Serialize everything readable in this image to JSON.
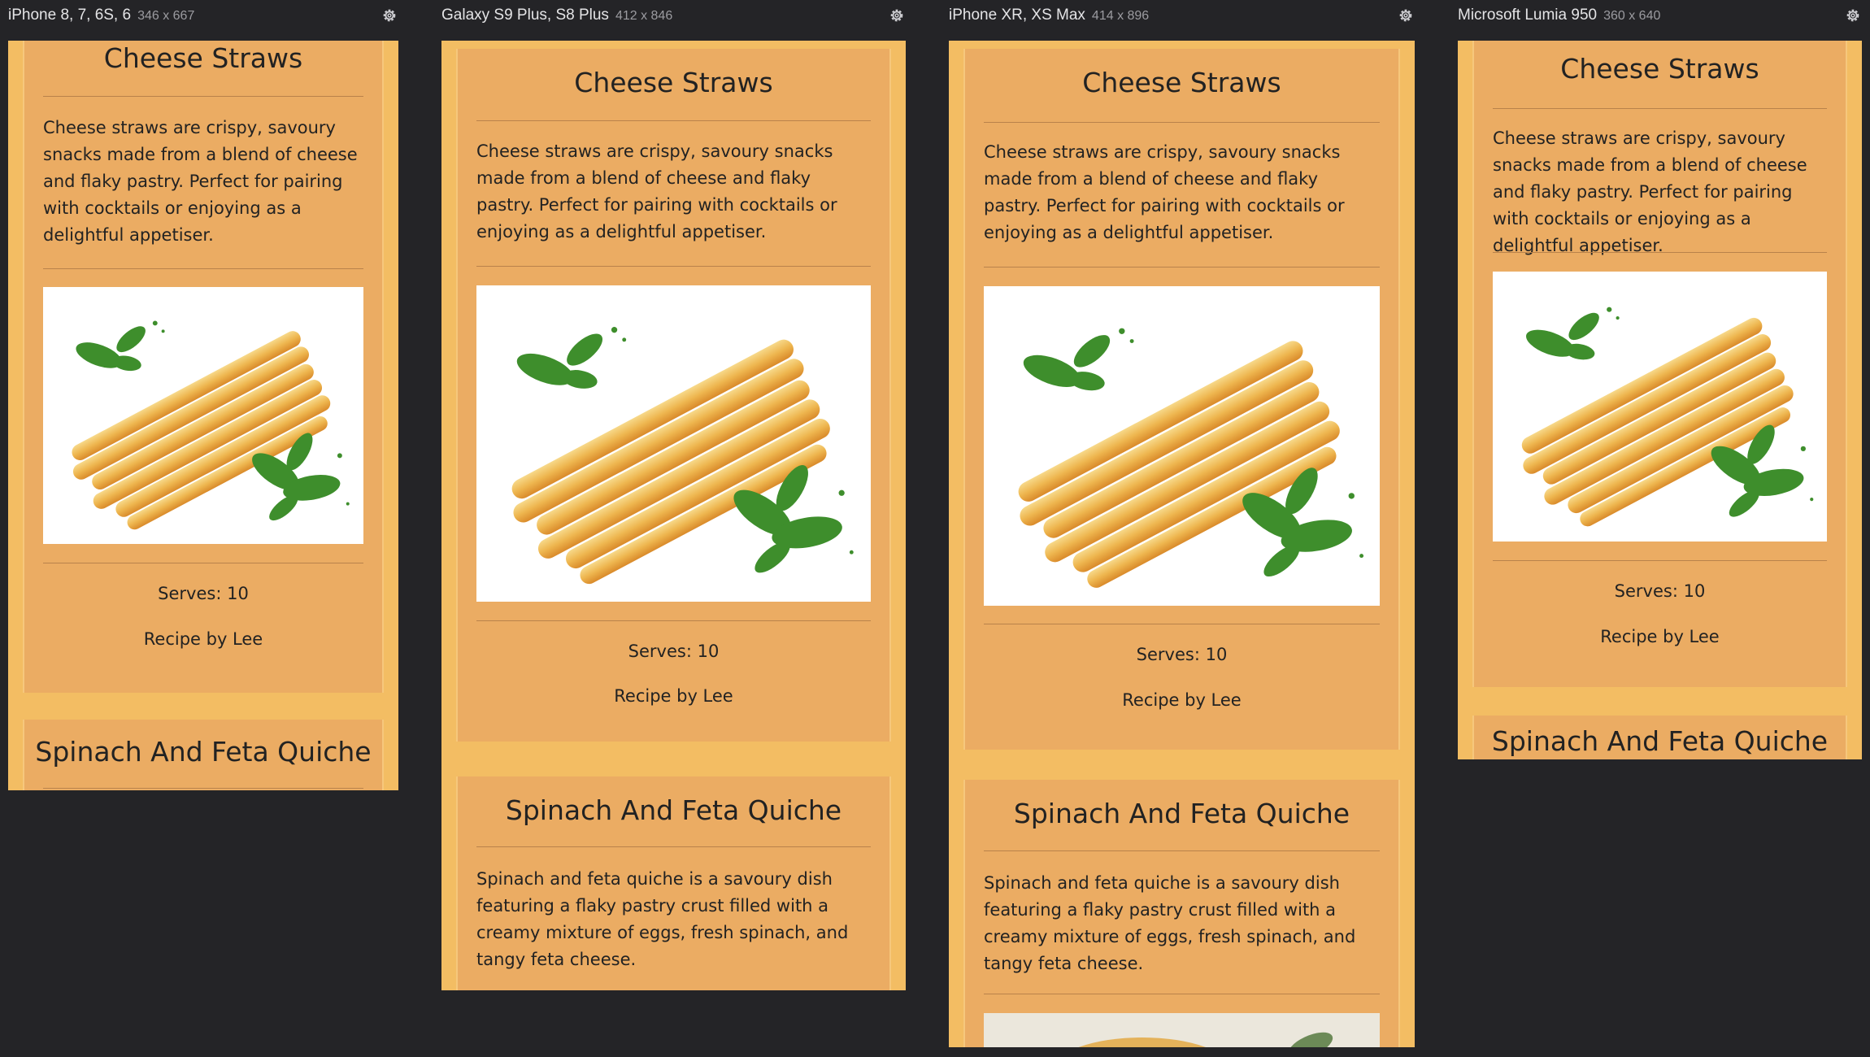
{
  "devices": [
    {
      "name": "iPhone 8, 7, 6S, 6",
      "dims": "346 x 667"
    },
    {
      "name": "Galaxy S9 Plus, S8 Plus",
      "dims": "412 x 846"
    },
    {
      "name": "iPhone XR, XS Max",
      "dims": "414 x 896"
    },
    {
      "name": "Microsoft Lumia 950",
      "dims": "360 x 640"
    }
  ],
  "recipes": [
    {
      "title": "Cheese Straws",
      "description": "Cheese straws are crispy, savoury snacks made from a blend of cheese and flaky pastry. Perfect for pairing with cocktails or enjoying as a delightful appetiser.",
      "serves": "Serves: 10",
      "author": "Recipe by Lee"
    },
    {
      "title": "Spinach And Feta Quiche",
      "description": "Spinach and feta quiche is a savoury dish featuring a flaky pastry crust filled with a creamy mixture of eggs, fresh spinach, and tangy feta cheese."
    }
  ],
  "icons": {
    "settings": "gear-icon"
  },
  "colors": {
    "background": "#242427",
    "page": "#f3bd63",
    "card": "#ebac63"
  }
}
